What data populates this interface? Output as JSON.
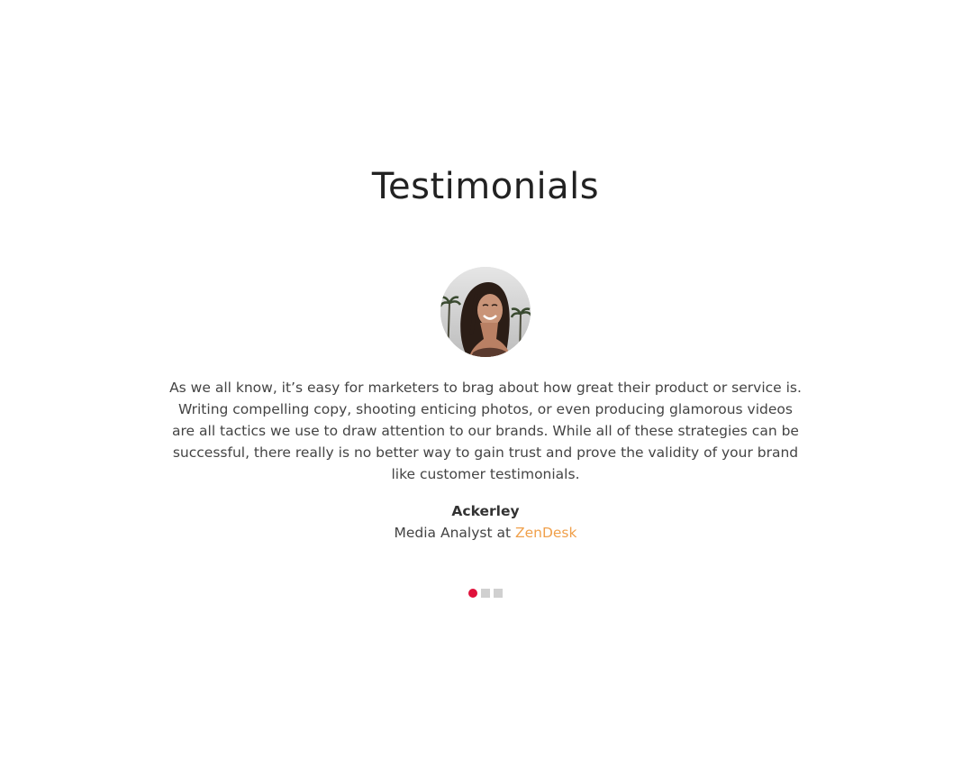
{
  "section": {
    "title": "Testimonials"
  },
  "testimonial": {
    "quote": "As we all know, it’s easy for marketers to brag about how great their product or service is. Writing compelling copy, shooting enticing photos, or even producing glamorous videos are all tactics we use to draw attention to our brands. While all of these strategies can be successful, there really is no better way to gain trust and prove the validity of your brand like customer testimonials.",
    "author_name": "Ackerley",
    "author_role_prefix": "Media Analyst at ",
    "company": "ZenDesk"
  },
  "carousel": {
    "slide_count": 3,
    "active_index": 0
  },
  "colors": {
    "accent": "#e0113b",
    "company_link": "#f0a04b",
    "inactive_dot": "#d0d0d0"
  }
}
